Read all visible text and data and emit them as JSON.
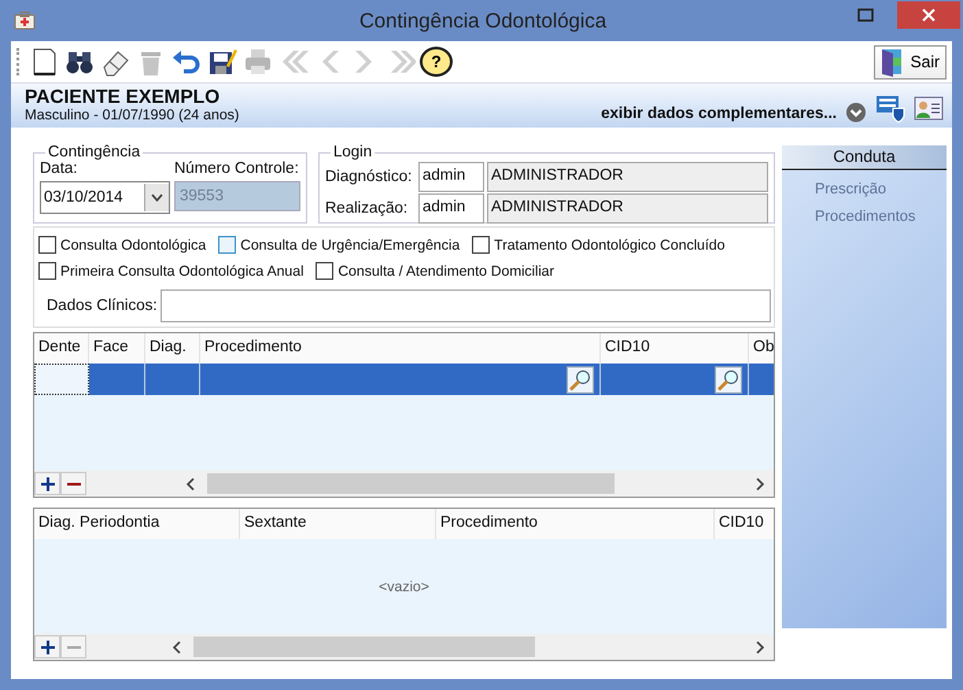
{
  "window": {
    "title": "Contingência Odontológica"
  },
  "toolbar": {
    "buttons": [
      {
        "kind": "new",
        "disabled": false
      },
      {
        "kind": "search",
        "disabled": false
      },
      {
        "kind": "clear",
        "disabled": false
      },
      {
        "kind": "delete",
        "disabled": true
      },
      {
        "kind": "undo",
        "disabled": false
      },
      {
        "kind": "save",
        "disabled": false
      },
      {
        "kind": "print",
        "disabled": true
      },
      {
        "kind": "first",
        "disabled": true
      },
      {
        "kind": "prev",
        "disabled": true
      },
      {
        "kind": "next",
        "disabled": true
      },
      {
        "kind": "last",
        "disabled": true
      },
      {
        "kind": "help",
        "disabled": false,
        "glyph": "?"
      }
    ],
    "exit_button": "Sair"
  },
  "patient": {
    "name": "PACIENTE EXEMPLO",
    "details": "Masculino - 01/07/1990 (24 anos)",
    "more_link": "exibir dados complementares..."
  },
  "contingencia": {
    "legend": "Contingência",
    "date_label": "Data:",
    "date": "03/10/2014",
    "control_label": "Número Controle:",
    "control": "39553"
  },
  "login": {
    "legend": "Login",
    "rows": [
      {
        "label": "Diagnóstico:",
        "user": "admin",
        "name": "ADMINISTRADOR"
      },
      {
        "label": "Realização:",
        "user": "admin",
        "name": "ADMINISTRADOR"
      }
    ]
  },
  "options": [
    {
      "label": "Consulta Odontológica",
      "checked": false,
      "focused": false
    },
    {
      "label": "Consulta de Urgência/Emergência",
      "checked": false,
      "focused": true
    },
    {
      "label": "Tratamento Odontológico Concluído",
      "checked": false,
      "focused": false
    },
    {
      "label": "Primeira Consulta Odontológica Anual",
      "checked": false,
      "focused": false
    },
    {
      "label": "Consulta / Atendimento Domiciliar",
      "checked": false,
      "focused": false
    }
  ],
  "clinical": {
    "label": "Dados Clínicos:"
  },
  "procedures_grid": {
    "columns": [
      {
        "label": "Dente",
        "lookup": false
      },
      {
        "label": "Face",
        "lookup": false
      },
      {
        "label": "Diag.",
        "lookup": false
      },
      {
        "label": "Procedimento",
        "lookup": true
      },
      {
        "label": "CID10",
        "lookup": true
      },
      {
        "label": "Ob",
        "lookup": false
      }
    ],
    "rows": [
      {
        "selected": true
      }
    ],
    "add_disabled": false,
    "remove_disabled": false
  },
  "periodontia_grid": {
    "columns": [
      {
        "label": "Diag. Periodontia"
      },
      {
        "label": "Sextante"
      },
      {
        "label": "Procedimento"
      },
      {
        "label": "CID10"
      }
    ],
    "empty_text": "<vazio>",
    "add_disabled": false,
    "remove_disabled": true
  },
  "conduta": {
    "title": "Conduta",
    "items": [
      {
        "label": "Prescrição",
        "disabled": true
      },
      {
        "label": "Procedimentos",
        "disabled": true
      }
    ]
  }
}
